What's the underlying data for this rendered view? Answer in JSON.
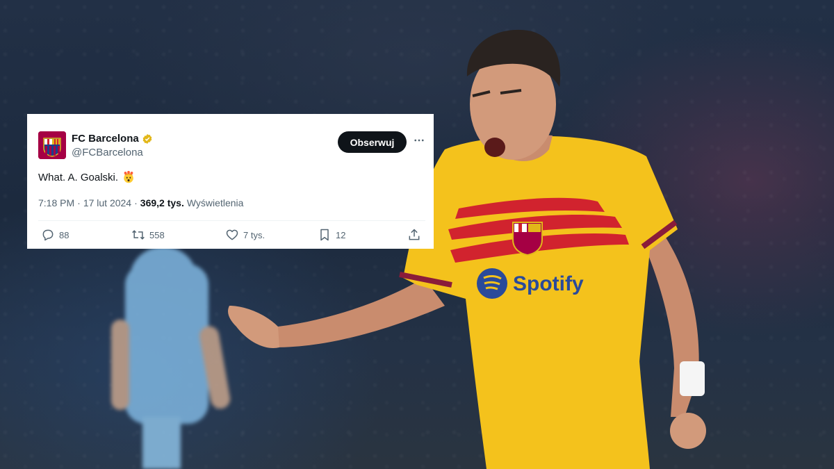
{
  "tweet": {
    "display_name": "FC Barcelona",
    "handle": "@FCBarcelona",
    "follow_label": "Obserwuj",
    "text": "What. A. Goalski.",
    "text_emoji": "exploding-head-emoji",
    "time": "7:18 PM",
    "date": "17 lut 2024",
    "separator": "·",
    "views_count": "369,2 tys.",
    "views_label": "Wyświetlenia",
    "actions": {
      "replies": "88",
      "retweets": "558",
      "likes": "7 tys.",
      "bookmarks": "12"
    },
    "icons": [
      "verified-badge-icon",
      "more-icon",
      "reply-icon",
      "retweet-icon",
      "like-icon",
      "bookmark-icon",
      "share-icon"
    ],
    "colors": {
      "follow_button": "#0f1419",
      "verified_badge": "#e2b719",
      "avatar_bg": "#a50044",
      "secondary_text": "#536471"
    }
  },
  "background": {
    "jersey_sponsor": "Spotify",
    "crest_text": "FCB",
    "colors": {
      "jersey": "#f4c21c",
      "stripes": "#d1232e",
      "opponent_kit": "#7fb6e0"
    }
  }
}
